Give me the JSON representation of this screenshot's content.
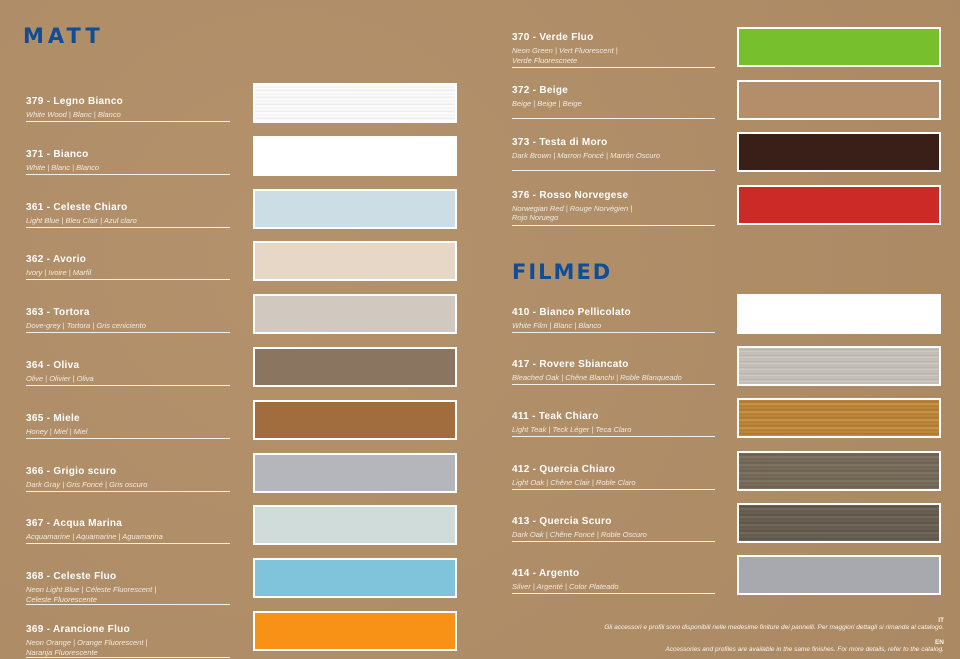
{
  "sections": {
    "matt_title": "MATT",
    "filmed_title": "FILMED"
  },
  "matt_left": [
    {
      "name": "379 - Legno Bianco",
      "sub": "White Wood | Blanc | Blanco",
      "color": "#ffffff",
      "texture": "wood-white"
    },
    {
      "name": "371 - Bianco",
      "sub": "White | Blanc | Blanco",
      "color": "#ffffff"
    },
    {
      "name": "361 - Celeste Chiaro",
      "sub": "Light Blue | Bleu Clair | Azul claro",
      "color": "#cddde6"
    },
    {
      "name": "362 - Avorio",
      "sub": "Ivory | Ivoire | Marfil",
      "color": "#e6d7c6"
    },
    {
      "name": "363 - Tortora",
      "sub": "Dove-grey | Tortora | Gris ceniciento",
      "color": "#d1c9c0"
    },
    {
      "name": "364 - Oliva",
      "sub": "Olive | Olivier | Oliva",
      "color": "#8a7660"
    },
    {
      "name": "365 - Miele",
      "sub": "Honey | Miel | Miel",
      "color": "#a26d3e"
    },
    {
      "name": "366 - Grigio scuro",
      "sub": "Dark Gray | Gris Foncé | Gris oscuro",
      "color": "#b4b6bb"
    },
    {
      "name": "367 - Acqua Marina",
      "sub": "Acquamarine | Aquamarine | Aguamarina",
      "color": "#cfdcd9"
    },
    {
      "name": "368 - Celeste Fluo",
      "sub": "Neon Light Blue | Céleste Fluorescent |\nCeleste Fluorescente",
      "color": "#80c4dc"
    },
    {
      "name": "369 - Arancione Fluo",
      "sub": "Neon Orange | Orange Fluorescent |\nNaranja Fluorescente",
      "color": "#f79216"
    }
  ],
  "matt_right": [
    {
      "name": "370 - Verde Fluo",
      "sub": "Neon Green | Vert Fluorescent |\nVerde Fluorescnete",
      "color": "#78bf2e"
    },
    {
      "name": "372 - Beige",
      "sub": "Beige | Beige | Beige",
      "color": "#b48e6a"
    },
    {
      "name": "373 - Testa di Moro",
      "sub": "Dark Brown | Marron Foncé | Marrón Oscuro",
      "color": "#3a1f18"
    },
    {
      "name": "376 - Rosso Norvegese",
      "sub": "Norwegian Red | Rouge Norvégien |\nRojo Noruego",
      "color": "#cc2a27"
    }
  ],
  "filmed": [
    {
      "name": "410 - Bianco Pellicolato",
      "sub": "White Film | Blanc | Blanco",
      "color": "#ffffff"
    },
    {
      "name": "417 - Rovere Sbiancato",
      "sub": "Bleached Oak | Chêne Blanchi | Roble Blanqueado",
      "color": "#c5c0b9",
      "texture": "wood-oak-bleached"
    },
    {
      "name": "411 - Teak Chiaro",
      "sub": "Light Teak | Teck Léger | Teca Claro",
      "color": "#bf8a3c",
      "texture": "wood-teak"
    },
    {
      "name": "412 - Quercia Chiaro",
      "sub": "Light Oak | Chêne Clair | Roble Claro",
      "color": "#776b5a",
      "texture": "wood-oak-light"
    },
    {
      "name": "413 - Quercia Scuro",
      "sub": "Dark Oak | Chêne Foncé | Roble Oscuro",
      "color": "#695f52",
      "texture": "wood-oak-dark"
    },
    {
      "name": "414 - Argento",
      "sub": "Silver | Argenté | Color Plateado",
      "color": "#a7a9ae"
    }
  ],
  "footer": {
    "it_label": "IT",
    "it_text": "Gli accessori e profili sono disponibili nelle medesime finiture dei pannelli. Per maggiori dettagli si rimanda al catalogo.",
    "en_label": "EN",
    "en_text": "Accessories and profiles are available in the same finishes. For more details, refer to the catalog."
  }
}
